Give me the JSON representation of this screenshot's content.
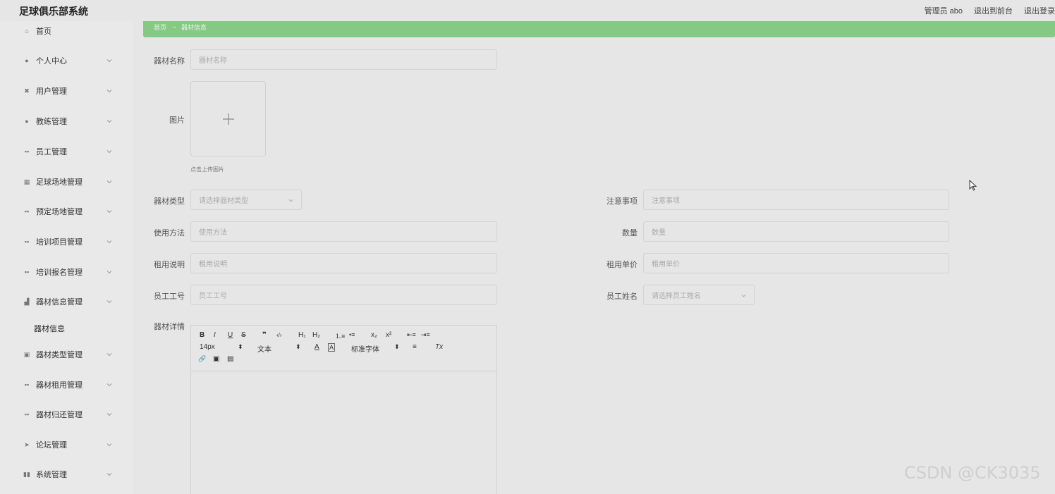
{
  "app": {
    "title": "足球俱乐部系统"
  },
  "header": {
    "user": "管理员 abo",
    "front": "退出到前台",
    "logout": "退出登录"
  },
  "sidebar": {
    "items": [
      {
        "label": "首页",
        "icon": "home-icon",
        "glyph": "⌂"
      },
      {
        "label": "个人中心",
        "icon": "user-icon",
        "glyph": "●"
      },
      {
        "label": "用户管理",
        "icon": "users-icon",
        "glyph": "✖"
      },
      {
        "label": "教练管理",
        "icon": "coach-icon",
        "glyph": "●"
      },
      {
        "label": "员工管理",
        "icon": "grid-icon",
        "glyph": "▪▪"
      },
      {
        "label": "足球场地管理",
        "icon": "field-icon",
        "glyph": "▦"
      },
      {
        "label": "预定场地管理",
        "icon": "grid-icon",
        "glyph": "▪▪"
      },
      {
        "label": "培训项目管理",
        "icon": "grid-icon",
        "glyph": "▪▪"
      },
      {
        "label": "培训报名管理",
        "icon": "grid-icon",
        "glyph": "▪▪"
      },
      {
        "label": "器材信息管理",
        "icon": "chart-icon",
        "glyph": "▟"
      },
      {
        "label": "器材类型管理",
        "icon": "clipboard-icon",
        "glyph": "▣"
      },
      {
        "label": "器材租用管理",
        "icon": "grid-icon",
        "glyph": "▪▪"
      },
      {
        "label": "器材归还管理",
        "icon": "grid-icon",
        "glyph": "▪▪"
      },
      {
        "label": "论坛管理",
        "icon": "send-icon",
        "glyph": "➤"
      },
      {
        "label": "系统管理",
        "icon": "bars-icon",
        "glyph": "▮▮"
      }
    ],
    "submenu": {
      "label": "器材信息"
    }
  },
  "breadcrumb": {
    "home": "首页",
    "separator": "→",
    "current": "器材信息"
  },
  "form": {
    "name": {
      "label": "器材名称",
      "placeholder": "器材名称"
    },
    "image": {
      "label": "图片",
      "tip": "点击上传图片"
    },
    "type": {
      "label": "器材类型",
      "placeholder": "请选择器材类型"
    },
    "notes": {
      "label": "注意事项",
      "placeholder": "注意事项"
    },
    "usage": {
      "label": "使用方法",
      "placeholder": "使用方法"
    },
    "quantity": {
      "label": "数量",
      "placeholder": "数量"
    },
    "rent_desc": {
      "label": "租用说明",
      "placeholder": "租用说明"
    },
    "rent_price": {
      "label": "租用单价",
      "placeholder": "租用单价"
    },
    "staff_no": {
      "label": "员工工号",
      "placeholder": "员工工号"
    },
    "staff_name": {
      "label": "员工姓名",
      "placeholder": "请选择员工姓名"
    },
    "detail": {
      "label": "器材详情"
    }
  },
  "editor": {
    "bold": "B",
    "italic": "I",
    "underline": "U",
    "strike": "S",
    "quote": "❞",
    "code": "‹/›",
    "h1": "H₁",
    "h2": "H₂",
    "ol": "⒈≡",
    "ul": "•≡",
    "sub": "x₂",
    "sup": "x²",
    "outdent": "⇤≡",
    "indent": "⇥≡",
    "size": "14px",
    "header": "文本",
    "font": "标准字体",
    "updown": "⬍",
    "color": "A",
    "bg": "A",
    "align": "≡",
    "clean": "Tx",
    "link": "🔗",
    "img": "▣",
    "video": "▤"
  },
  "watermark": "CSDN @CK3035"
}
